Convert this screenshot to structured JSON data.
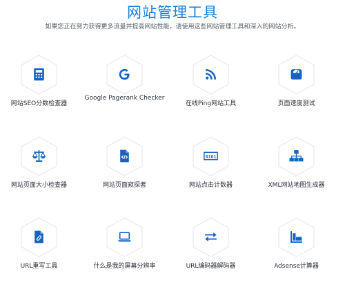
{
  "header": {
    "title": "网站管理工具",
    "subtitle": "如果您正在努力获得更多流量并提高网站性能，请使用这些网站管理工具和深入的网站分析。"
  },
  "colors": {
    "accent": "#1a7fd6",
    "icon": "#1565c0",
    "hex_border": "#e6e8eb",
    "text": "#2d3138",
    "subtext": "#555b63"
  },
  "tools": [
    {
      "label": "网站SEO分数检查器",
      "icon": "calculator-icon"
    },
    {
      "label": "Google Pagerank Checker",
      "icon": "google-icon"
    },
    {
      "label": "在线Ping网站工具",
      "icon": "rss-icon"
    },
    {
      "label": "页面速度测试",
      "icon": "scale-icon"
    },
    {
      "label": "网站页面大小检查器",
      "icon": "balance-icon"
    },
    {
      "label": "网站页面窥探者",
      "icon": "code-file-icon"
    },
    {
      "label": "网站点击计数器",
      "icon": "counter-icon"
    },
    {
      "label": "XML网站地图生成器",
      "icon": "sitemap-icon"
    },
    {
      "label": "URL重写工具",
      "icon": "link-file-icon"
    },
    {
      "label": "什么是我的屏幕分辨率",
      "icon": "laptop-icon"
    },
    {
      "label": "URL编码器解码器",
      "icon": "exchange-icon"
    },
    {
      "label": "Adsense计算器",
      "icon": "chart-icon"
    }
  ]
}
